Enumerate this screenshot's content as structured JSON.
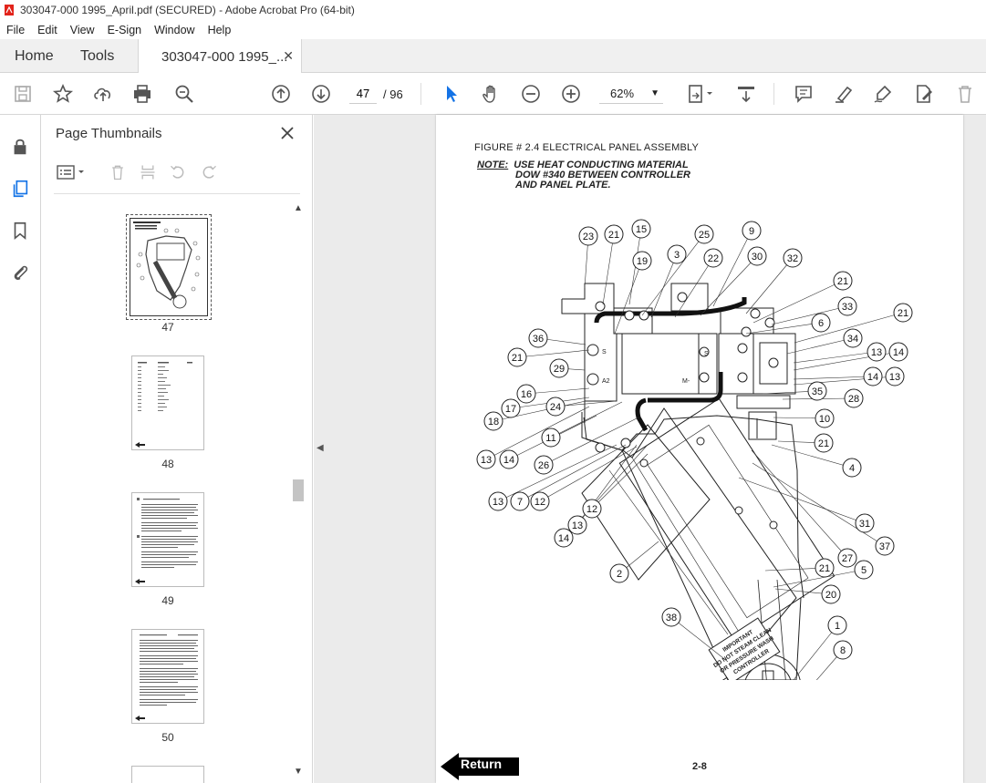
{
  "window": {
    "title": "303047-000 1995_April.pdf (SECURED) - Adobe Acrobat Pro (64-bit)"
  },
  "menu": [
    "File",
    "Edit",
    "View",
    "E-Sign",
    "Window",
    "Help"
  ],
  "tabs": {
    "home": "Home",
    "tools": "Tools",
    "document": "303047-000 1995_..."
  },
  "toolbar": {
    "current_page": "47",
    "total_pages": "/ 96",
    "zoom": "62%"
  },
  "panel": {
    "title": "Page Thumbnails"
  },
  "thumbnails": [
    {
      "label": "47"
    },
    {
      "label": "48"
    },
    {
      "label": "49"
    },
    {
      "label": "50"
    }
  ],
  "document_page": {
    "figure_title": "FIGURE # 2.4  ELECTRICAL PANEL ASSEMBLY",
    "note_label": "NOTE:",
    "note_lines": [
      "USE HEAT CONDUCTING MATERIAL",
      "DOW #340  BETWEEN CONTROLLER",
      "AND PANEL PLATE."
    ],
    "return_label": "Return",
    "page_number": "2-8",
    "warning_lines": [
      "IMPORTANT",
      "DO NOT STEAM CLEAN",
      "OR PRESSURE WASH",
      "CONTROLLER"
    ],
    "terminal_labels": [
      "S",
      "S",
      "A2",
      "M-"
    ],
    "callouts": [
      "23",
      "21",
      "15",
      "19",
      "3",
      "25",
      "22",
      "9",
      "30",
      "32",
      "21",
      "33",
      "6",
      "21",
      "36",
      "21",
      "34",
      "13",
      "14",
      "29",
      "14",
      "13",
      "16",
      "24",
      "35",
      "28",
      "17",
      "11",
      "10",
      "18",
      "21",
      "13",
      "14",
      "26",
      "4",
      "12",
      "13",
      "7",
      "12",
      "13",
      "14",
      "31",
      "37",
      "2",
      "27",
      "21",
      "5",
      "20",
      "38",
      "1",
      "8"
    ]
  }
}
